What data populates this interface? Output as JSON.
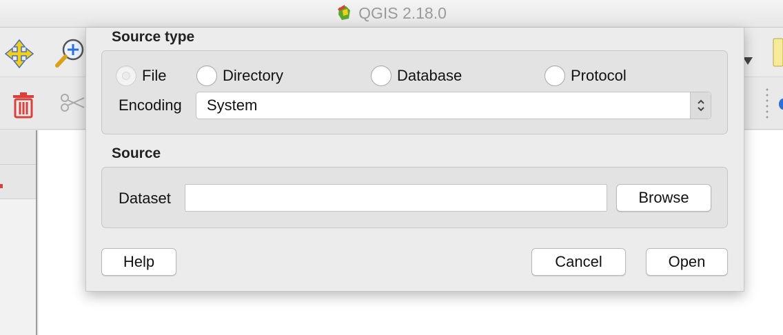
{
  "window": {
    "title": "QGIS 2.18.0",
    "app_icon": "qgis-logo-icon"
  },
  "colors": {
    "accent_yellow": "#f2cf1c",
    "delete_red": "#d9413a"
  },
  "dialog": {
    "source_type": {
      "title": "Source type",
      "radios": [
        {
          "label": "File",
          "checked": false,
          "enabled": false
        },
        {
          "label": "Directory",
          "checked": false,
          "enabled": true
        },
        {
          "label": "Database",
          "checked": false,
          "enabled": true
        },
        {
          "label": "Protocol",
          "checked": false,
          "enabled": true
        }
      ],
      "encoding_label": "Encoding",
      "encoding_value": "System"
    },
    "source": {
      "title": "Source",
      "dataset_label": "Dataset",
      "dataset_value": "",
      "browse_label": "Browse"
    },
    "buttons": {
      "help": "Help",
      "cancel": "Cancel",
      "open": "Open"
    }
  }
}
